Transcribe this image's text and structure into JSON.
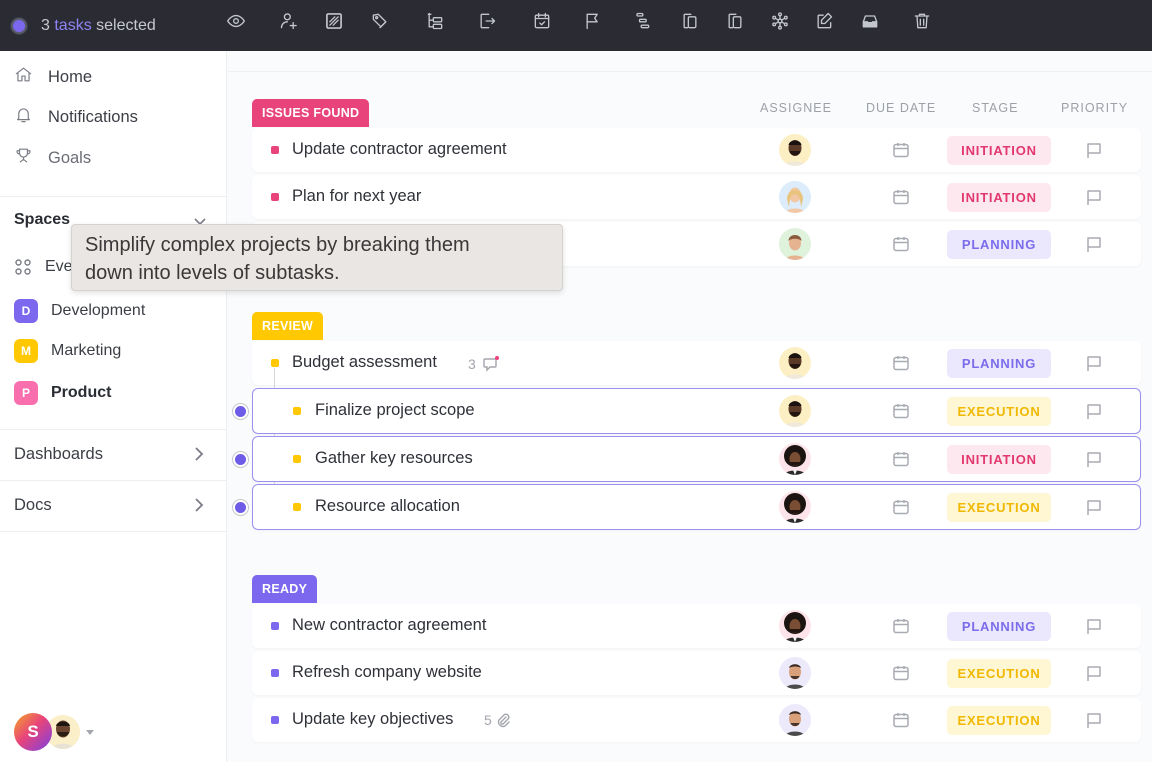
{
  "topbar": {
    "selection": {
      "count": "3",
      "noun": "tasks",
      "suffix": "selected"
    },
    "icons": [
      "eye-icon",
      "add-assignee-icon",
      "status-icon",
      "tag-icon",
      "subtasks-icon",
      "move-icon",
      "due-date-icon",
      "priority-flag-icon",
      "dependencies-icon",
      "duplicate-icon",
      "copy-icon",
      "relationships-icon",
      "edit-icon",
      "archive-inbox-icon",
      "trash-icon"
    ]
  },
  "sidebar": {
    "nav": [
      {
        "label": "Home",
        "icon": "home-icon"
      },
      {
        "label": "Notifications",
        "icon": "bell-icon"
      },
      {
        "label": "Goals",
        "icon": "trophy-icon"
      }
    ],
    "spaces_title": "Spaces",
    "everything_label": "Eve",
    "spaces": [
      {
        "initial": "D",
        "label": "Development",
        "color": "#7b68ee"
      },
      {
        "initial": "M",
        "label": "Marketing",
        "color": "#ffc800"
      },
      {
        "initial": "P",
        "label": "Product",
        "color": "#f96fae"
      }
    ],
    "sections": [
      {
        "label": "Dashboards"
      },
      {
        "label": "Docs"
      }
    ],
    "user_initial": "S"
  },
  "tooltip": {
    "line1": "Simplify complex projects by breaking them",
    "line2": "down into levels of subtasks."
  },
  "columns": {
    "assignee": "ASSIGNEE",
    "due_date": "DUE DATE",
    "stage": "STAGE",
    "priority": "PRIORITY"
  },
  "stages": {
    "INITIATION": {
      "bg": "#fde8ef",
      "fg": "#e2386f"
    },
    "PLANNING": {
      "bg": "#ebe8fd",
      "fg": "#7b6cec"
    },
    "EXECUTION": {
      "bg": "#fff6d4",
      "fg": "#f0b800"
    }
  },
  "groups": [
    {
      "tag": "ISSUES FOUND",
      "color": "#e8437a",
      "tasks": [
        {
          "name": "Update contractor agreement",
          "stage": "INITIATION"
        },
        {
          "name": "Plan for next year",
          "stage": "INITIATION"
        },
        {
          "name": "",
          "stage": "PLANNING"
        }
      ]
    },
    {
      "tag": "REVIEW",
      "color": "#ffc800",
      "tasks": [
        {
          "name": "Budget assessment",
          "stage": "PLANNING",
          "comments": "3"
        },
        {
          "name": "Finalize project scope",
          "stage": "EXECUTION",
          "selected": true
        },
        {
          "name": "Gather key resources",
          "stage": "INITIATION",
          "selected": true
        },
        {
          "name": "Resource allocation",
          "stage": "EXECUTION",
          "selected": true
        }
      ]
    },
    {
      "tag": "READY",
      "color": "#7b68ee",
      "tasks": [
        {
          "name": "New contractor agreement",
          "stage": "PLANNING"
        },
        {
          "name": "Refresh company website",
          "stage": "EXECUTION"
        },
        {
          "name": "Update key objectives",
          "stage": "EXECUTION",
          "attachments": "5"
        }
      ]
    }
  ]
}
